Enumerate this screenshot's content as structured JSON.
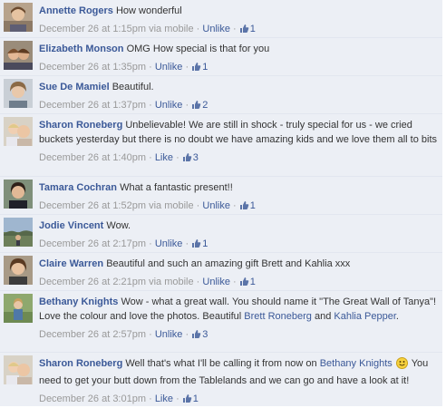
{
  "comments": [
    {
      "author": "Annette Rogers",
      "text": "How wonderful",
      "time": "December 26 at 1:15pm",
      "via": "via mobile",
      "action": "Unlike",
      "likes": "1"
    },
    {
      "author": "Elizabeth Monson",
      "text": "OMG How special is that for you",
      "time": "December 26 at 1:35pm",
      "action": "Unlike",
      "likes": "1"
    },
    {
      "author": "Sue De Mamiel",
      "text": "Beautiful.",
      "time": "December 26 at 1:37pm",
      "action": "Unlike",
      "likes": "2"
    },
    {
      "author": "Sharon Roneberg",
      "text": "Unbelievable! We are still in shock - truly special for us - we cried buckets yesterday but there is no doubt we have amazing kids and we love them all to bits",
      "time": "December 26 at 1:40pm",
      "action": "Like",
      "likes": "3"
    },
    {
      "author": "Tamara Cochran",
      "text": "What a fantastic present!!",
      "time": "December 26 at 1:52pm",
      "via": "via mobile",
      "action": "Unlike",
      "likes": "1"
    },
    {
      "author": "Jodie Vincent",
      "text": "Wow.",
      "time": "December 26 at 2:17pm",
      "action": "Unlike",
      "likes": "1"
    },
    {
      "author": "Claire Warren",
      "text": "Beautiful and such an amazing gift Brett and Kahlia xxx",
      "time": "December 26 at 2:21pm",
      "via": "via mobile",
      "action": "Unlike",
      "likes": "1"
    },
    {
      "author": "Bethany Knights",
      "text_before": "Wow - what a great wall. You should name it \"The Great Wall of Tanya\"! Love the colour and love the photos. Beautiful",
      "mention_1": "Brett Roneberg",
      "text_middle": "and",
      "mention_2": "Kahlia Pepper",
      "text_after": ".",
      "time": "December 26 at 2:57pm",
      "action": "Unlike",
      "likes": "3"
    },
    {
      "author": "Sharon Roneberg",
      "text_before": "Well that's what I'll be calling it from now on",
      "mention_1": "Bethany Knights",
      "text_after": "You need to get your butt down from the Tablelands and we can go and have a look at it!",
      "time": "December 26 at 3:01pm",
      "action": "Like",
      "likes": "1"
    }
  ],
  "colors": {
    "background": "#eceff5",
    "link": "#3b5998",
    "meta": "#999999",
    "text": "#333333"
  },
  "icons": {
    "like_count": "thumbs-up-icon",
    "emoticon": "smiley-icon"
  }
}
